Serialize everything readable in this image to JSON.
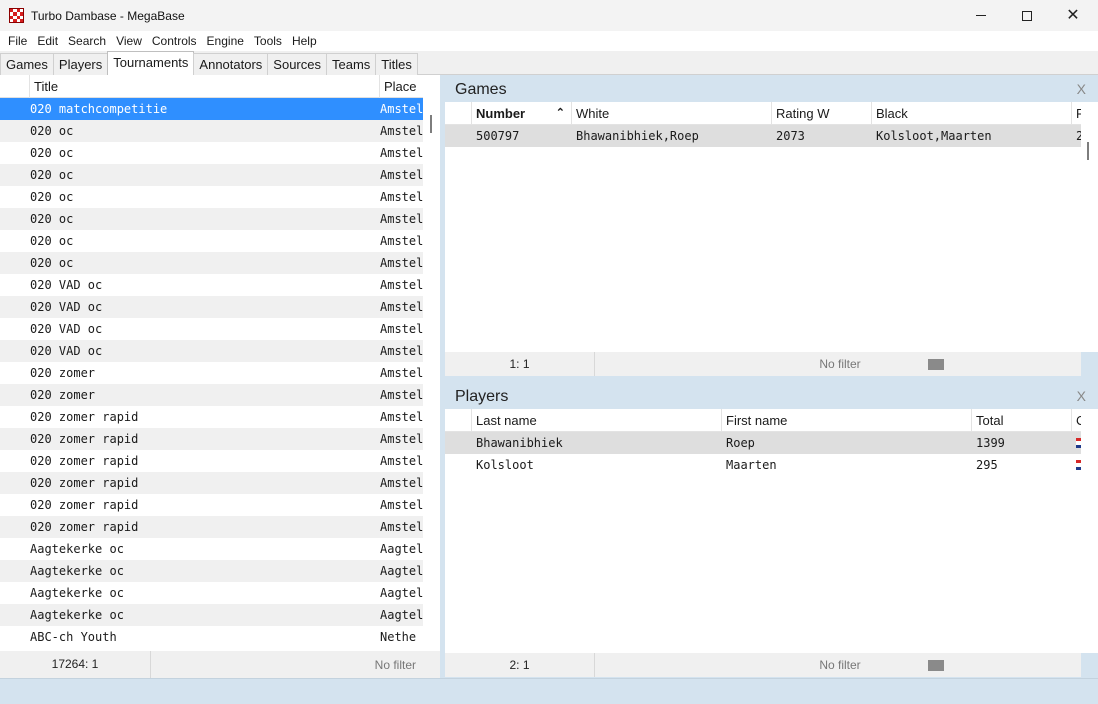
{
  "window": {
    "title": "Turbo Dambase - MegaBase",
    "minimize": "–",
    "maximize": "□",
    "close": "✕"
  },
  "menu": [
    "File",
    "Edit",
    "Search",
    "View",
    "Controls",
    "Engine",
    "Tools",
    "Help"
  ],
  "tabs": [
    "Games",
    "Players",
    "Tournaments",
    "Annotators",
    "Sources",
    "Teams",
    "Titles"
  ],
  "active_tab": "Tournaments",
  "tournaments": {
    "columns": [
      "Title",
      "Place"
    ],
    "rows": [
      {
        "title": "020 matchcompetitie",
        "place": "Amstel",
        "selected": true
      },
      {
        "title": "020 oc",
        "place": "Amstel"
      },
      {
        "title": "020 oc",
        "place": "Amstel"
      },
      {
        "title": "020 oc",
        "place": "Amstel"
      },
      {
        "title": "020 oc",
        "place": "Amstel"
      },
      {
        "title": "020 oc",
        "place": "Amstel"
      },
      {
        "title": "020 oc",
        "place": "Amstel"
      },
      {
        "title": "020 oc",
        "place": "Amstel"
      },
      {
        "title": "020 VAD oc",
        "place": "Amstel"
      },
      {
        "title": "020 VAD oc",
        "place": "Amstel"
      },
      {
        "title": "020 VAD oc",
        "place": "Amstel"
      },
      {
        "title": "020 VAD oc",
        "place": "Amstel"
      },
      {
        "title": "020 zomer",
        "place": "Amstel"
      },
      {
        "title": "020 zomer",
        "place": "Amstel"
      },
      {
        "title": "020 zomer rapid",
        "place": "Amstel"
      },
      {
        "title": "020 zomer rapid",
        "place": "Amstel"
      },
      {
        "title": "020 zomer rapid",
        "place": "Amstel"
      },
      {
        "title": "020 zomer rapid",
        "place": "Amstel"
      },
      {
        "title": "020 zomer rapid",
        "place": "Amstel"
      },
      {
        "title": "020 zomer rapid",
        "place": "Amstel"
      },
      {
        "title": "Aagtekerke oc",
        "place": "Aagtel"
      },
      {
        "title": "Aagtekerke oc",
        "place": "Aagtel"
      },
      {
        "title": "Aagtekerke oc",
        "place": "Aagtel"
      },
      {
        "title": "Aagtekerke oc",
        "place": "Aagtel"
      },
      {
        "title": "ABC-ch Youth",
        "place": "Nethe"
      }
    ],
    "status_count": "17264: 1",
    "status_filter": "No filter"
  },
  "games": {
    "title": "Games",
    "close": "X",
    "columns": [
      "Number",
      "White",
      "Rating W",
      "Black",
      "Rati"
    ],
    "rows": [
      {
        "number": "500797",
        "white": "Bhawanibhiek,Roep",
        "rating_w": "2073",
        "black": "Kolsloot,Maarten",
        "rating_b": "2"
      }
    ],
    "status_count": "1: 1",
    "status_filter": "No filter"
  },
  "players": {
    "title": "Players",
    "close": "X",
    "columns": [
      "Last name",
      "First name",
      "Total",
      "Cou"
    ],
    "rows": [
      {
        "last": "Bhawanibhiek",
        "first": "Roep",
        "total": "1399"
      },
      {
        "last": "Kolsloot",
        "first": "Maarten",
        "total": "295"
      }
    ],
    "status_count": "2: 1",
    "status_filter": "No filter"
  },
  "colors": {
    "selection": "#2f8fff",
    "panel_bg": "#d4e3ef",
    "flag_red": "#d62828",
    "flag_white": "#ffffff",
    "flag_blue": "#1e3a8a"
  }
}
